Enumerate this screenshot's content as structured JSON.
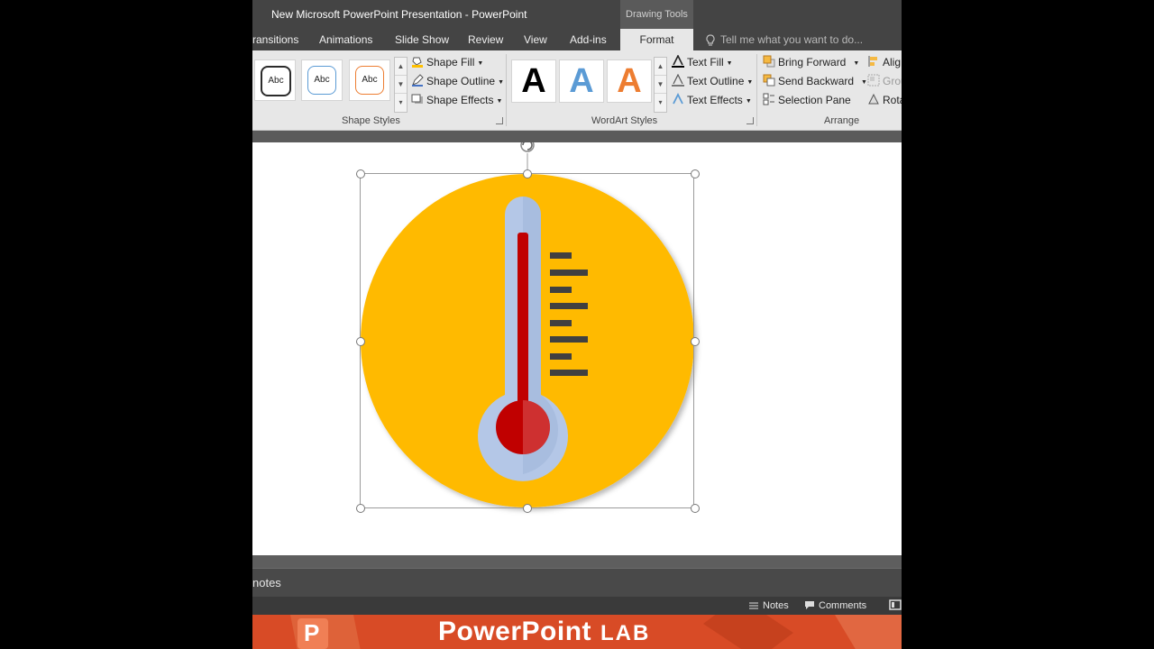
{
  "window": {
    "title": "New Microsoft PowerPoint Presentation - PowerPoint",
    "context_tab": "Drawing Tools"
  },
  "tabs": [
    {
      "label": "ransitions"
    },
    {
      "label": "Animations"
    },
    {
      "label": "Slide Show"
    },
    {
      "label": "Review"
    },
    {
      "label": "View"
    },
    {
      "label": "Add-ins"
    },
    {
      "label": "Format",
      "active": true
    }
  ],
  "tell_me": {
    "placeholder": "Tell me what you want to do..."
  },
  "ribbon": {
    "shape_styles": {
      "label": "Shape Styles",
      "thumbs": [
        {
          "text": "Abc",
          "border_color": "#2b2b2b"
        },
        {
          "text": "Abc",
          "border_color": "#5b9bd5"
        },
        {
          "text": "Abc",
          "border_color": "#ed7d31"
        }
      ],
      "shape_fill": "Shape Fill",
      "shape_outline": "Shape Outline",
      "shape_effects": "Shape Effects"
    },
    "wordart_styles": {
      "label": "WordArt Styles",
      "thumbs": [
        {
          "text": "A",
          "color": "#000000"
        },
        {
          "text": "A",
          "color": "#5b9bd5"
        },
        {
          "text": "A",
          "color": "#ed7d31"
        }
      ],
      "text_fill": "Text Fill",
      "text_outline": "Text Outline",
      "text_effects": "Text Effects"
    },
    "arrange": {
      "label": "Arrange",
      "bring_forward": "Bring Forward",
      "send_backward": "Send Backward",
      "selection_pane": "Selection Pane",
      "align": "Alig",
      "group": "Grou",
      "rotate": "Rota"
    }
  },
  "notes_pane": {
    "label": "notes"
  },
  "status_bar": {
    "notes": "Notes",
    "comments": "Comments"
  },
  "banner": {
    "text": "PowerPoint",
    "lab": "LAB"
  },
  "colors": {
    "circle": "#ffba00",
    "thermo_tube": "#b4c7e7",
    "mercury": "#c00000",
    "ticks": "#404040",
    "banner": "#d84b26"
  }
}
